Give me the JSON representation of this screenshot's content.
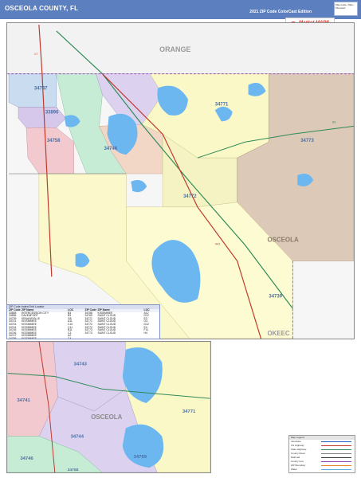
{
  "header": {
    "title": "OSCEOLA COUNTY, FL",
    "edition": "2021 ZIP Code ColorCast Edition",
    "corner_note": "Map scale / Mile / Kilometer",
    "colors": {
      "bar": "#5b7fbf",
      "text": "#ffffff"
    }
  },
  "logo": {
    "glyph": "M",
    "brand": "Market MAPS",
    "tagline": "Bringing Maps to Business - Market Maps Inc."
  },
  "main_map": {
    "labels": {
      "county_orange": "ORANGE",
      "county_osceola": "OSCEOLA",
      "county_okeechobee": "OKEEC",
      "zip_34747": "34747",
      "zip_33896": "33896",
      "zip_34758": "34758",
      "zip_34746": "34746",
      "zip_34771": "34771",
      "zip_34772": "34772",
      "zip_34773": "34773",
      "zip_34739": "34739",
      "road_17": "17",
      "road_441": "441",
      "road_60": "60"
    }
  },
  "inset_map": {
    "labels": {
      "zip_34741": "34741",
      "zip_34743": "34743",
      "zip_34771": "34771",
      "zip_34744": "34744",
      "zip_34746": "34746",
      "zip_34758": "34758",
      "zip_34769": "34769",
      "city": "OSCEOLA"
    }
  },
  "legend": {
    "title": "ZIP Code Index/Grid Locator",
    "headers": {
      "zip": "ZIP Code",
      "name": "ZIP Name",
      "loc": "LOC"
    },
    "left_rows": [
      {
        "zip": "33848",
        "name": "INTERCESSION CITY",
        "loc": "B3"
      },
      {
        "zip": "33896",
        "name": "DAVENPORT",
        "loc": "B3"
      },
      {
        "zip": "34739",
        "name": "KENANSVILLE",
        "loc": "G8"
      },
      {
        "zip": "34741",
        "name": "KISSIMMEE",
        "loc": "A11"
      },
      {
        "zip": "34743",
        "name": "KISSIMMEE",
        "loc": "C10"
      },
      {
        "zip": "34744",
        "name": "KISSIMMEE",
        "loc": "C11"
      },
      {
        "zip": "34746",
        "name": "KISSIMMEE",
        "loc": "B11"
      },
      {
        "zip": "34746",
        "name": "KISSIMMEE",
        "loc": "C3"
      },
      {
        "zip": "34747",
        "name": "KISSIMMEE",
        "loc": "A2"
      },
      {
        "zip": "34758",
        "name": "KISSIMMEE",
        "loc": "C4"
      }
    ],
    "right_rows": [
      {
        "zip": "34758",
        "name": "KISSIMMEE",
        "loc": "A12"
      },
      {
        "zip": "34769",
        "name": "SAINT CLOUD",
        "loc": "D12"
      },
      {
        "zip": "34771",
        "name": "SAINT CLOUD",
        "loc": "E3"
      },
      {
        "zip": "34771",
        "name": "SAINT CLOUD",
        "loc": "G3"
      },
      {
        "zip": "34772",
        "name": "SAINT CLOUD",
        "loc": "D12"
      },
      {
        "zip": "34772",
        "name": "SAINT CLOUD",
        "loc": "E4"
      },
      {
        "zip": "34773",
        "name": "SAINT CLOUD",
        "loc": "F11"
      },
      {
        "zip": "34773",
        "name": "SAINT CLOUD",
        "loc": "H4"
      }
    ]
  },
  "map_key": {
    "title": "Map Legend",
    "items": [
      {
        "label": "Interstate",
        "color": "#1f5fbf"
      },
      {
        "label": "US Highway",
        "color": "#c0392b"
      },
      {
        "label": "State Highway",
        "color": "#2e8b57"
      },
      {
        "label": "County Road",
        "color": "#7a7a7a"
      },
      {
        "label": "Railroad",
        "color": "#333333"
      },
      {
        "label": "County Line",
        "color": "#8e44ad"
      },
      {
        "label": "ZIP Boundary",
        "color": "#e67e22"
      },
      {
        "label": "Water",
        "color": "#5aa9e6"
      }
    ]
  }
}
